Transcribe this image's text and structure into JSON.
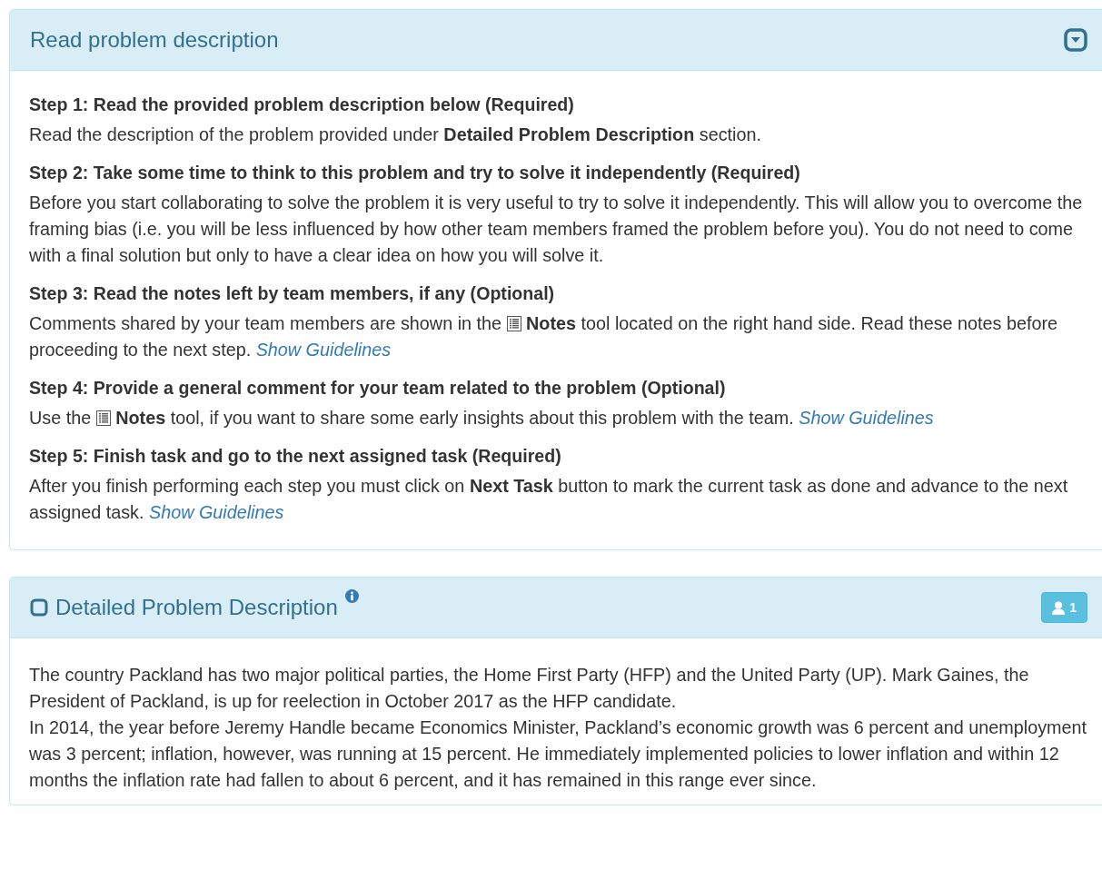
{
  "panels": [
    {
      "title": "Read problem description",
      "kind": "steps",
      "collapse_toggle": true,
      "steps": [
        {
          "title": "Step 1: Read the provided problem description below (Required)",
          "parts": [
            {
              "kind": "text",
              "text": "Read the description of the problem provided under **Detailed Problem Description** section."
            }
          ]
        },
        {
          "title": "Step 2: Take some time to think to this problem and try to solve it independently (Required)",
          "parts": [
            {
              "kind": "text",
              "text": "Before you start collaborating to solve the problem it is very useful to try to solve it independently. This will allow you to overcome the framing bias (i.e. you will be less influenced by how other team members framed the problem before you). You do not need to come with a final solution but only to have a clear idea on how you will solve it."
            }
          ]
        },
        {
          "title": "Step 3: Read the notes left by team members, if any (Optional)",
          "parts": [
            {
              "kind": "text",
              "text": "Comments shared by your team members are shown in the "
            },
            {
              "kind": "icon"
            },
            {
              "kind": "text",
              "text": " **Notes** tool located on the right hand side. Read these notes before proceeding to the next step. "
            },
            {
              "kind": "link",
              "text": "Show Guidelines"
            }
          ]
        },
        {
          "title": "Step 4: Provide a general comment for your team related to the problem (Optional)",
          "parts": [
            {
              "kind": "text",
              "text": "Use the "
            },
            {
              "kind": "icon"
            },
            {
              "kind": "text",
              "text": " **Notes** tool, if you want to share some early insights about this problem with the team. "
            },
            {
              "kind": "link",
              "text": "Show Guidelines"
            }
          ]
        },
        {
          "title": "Step 5: Finish task and go to the next assigned task (Required)",
          "parts": [
            {
              "kind": "text",
              "text": "After you finish performing each step you must click on **Next Task** button to mark the current task as done and advance to the next assigned task. "
            },
            {
              "kind": "link",
              "text": "Show Guidelines"
            }
          ]
        }
      ]
    },
    {
      "title": "Detailed Problem Description",
      "kind": "description",
      "checked": false,
      "info": true,
      "badge": "1",
      "paragraphs": [
        "The country Packland has two major political parties, the Home First Party (HFP) and the United Party (UP). Mark Gaines, the President of Packland, is up for reelection in October 2017 as the HFP candidate.",
        "In 2014, the year before Jeremy Handle became Economics Minister, Packland’s economic growth was 6 percent and unemployment was 3 percent; inflation, however, was running at 15 percent. He immediately implemented policies to lower inflation and within 12 months the inflation rate had fallen to about 6 percent, and it has remained in this range ever since."
      ]
    }
  ]
}
